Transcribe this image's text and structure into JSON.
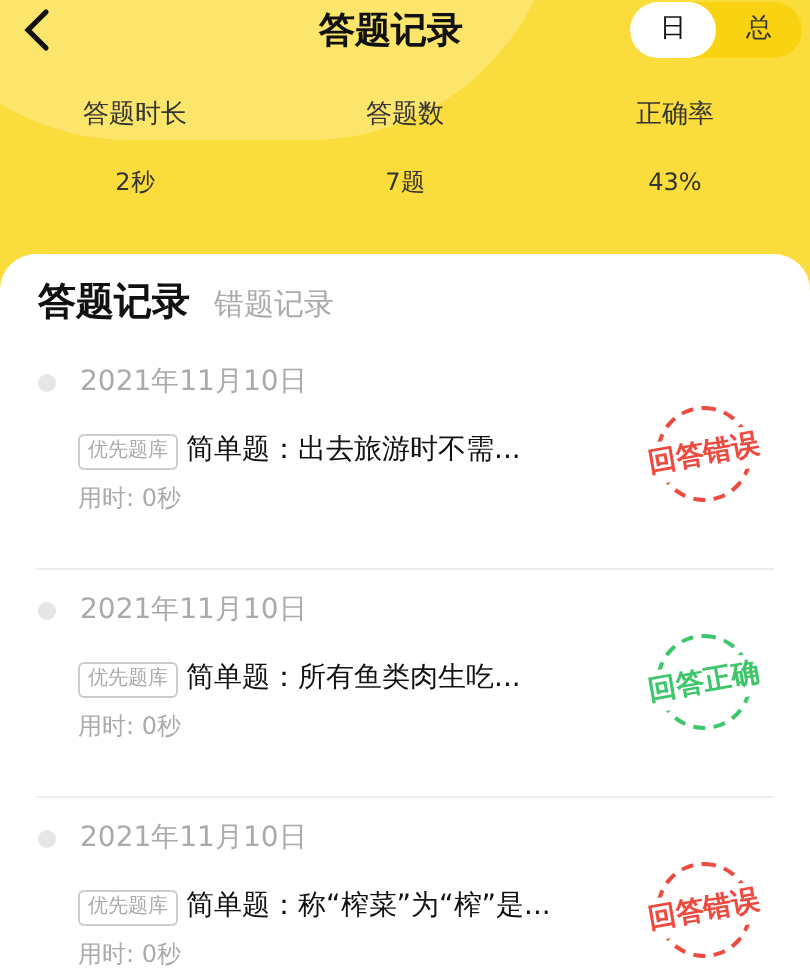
{
  "header": {
    "title": "答题记录"
  },
  "period_toggle": [
    {
      "label": "日",
      "selected": true
    },
    {
      "label": "总",
      "selected": false
    }
  ],
  "stats": [
    {
      "label": "答题时长",
      "value": "2秒"
    },
    {
      "label": "答题数",
      "value": "7题"
    },
    {
      "label": "正确率",
      "value": "43%"
    }
  ],
  "tabs": [
    {
      "label": "答题记录",
      "selected": true
    },
    {
      "label": "错题记录",
      "selected": false
    }
  ],
  "records": [
    {
      "date": "2021年11月10日",
      "tag": "优先题库",
      "question": "简单题：出去旅游时不需...",
      "time": "用时: 0秒",
      "result": {
        "kind": "wrong",
        "label": "回答错误"
      }
    },
    {
      "date": "2021年11月10日",
      "tag": "优先题库",
      "question": "简单题：所有鱼类肉生吃...",
      "time": "用时: 0秒",
      "result": {
        "kind": "correct",
        "label": "回答正确"
      }
    },
    {
      "date": "2021年11月10日",
      "tag": "优先题库",
      "question": "简单题：称“榨菜”为“榨”是...",
      "time": "用时: 0秒",
      "result": {
        "kind": "wrong",
        "label": "回答错误"
      }
    }
  ]
}
